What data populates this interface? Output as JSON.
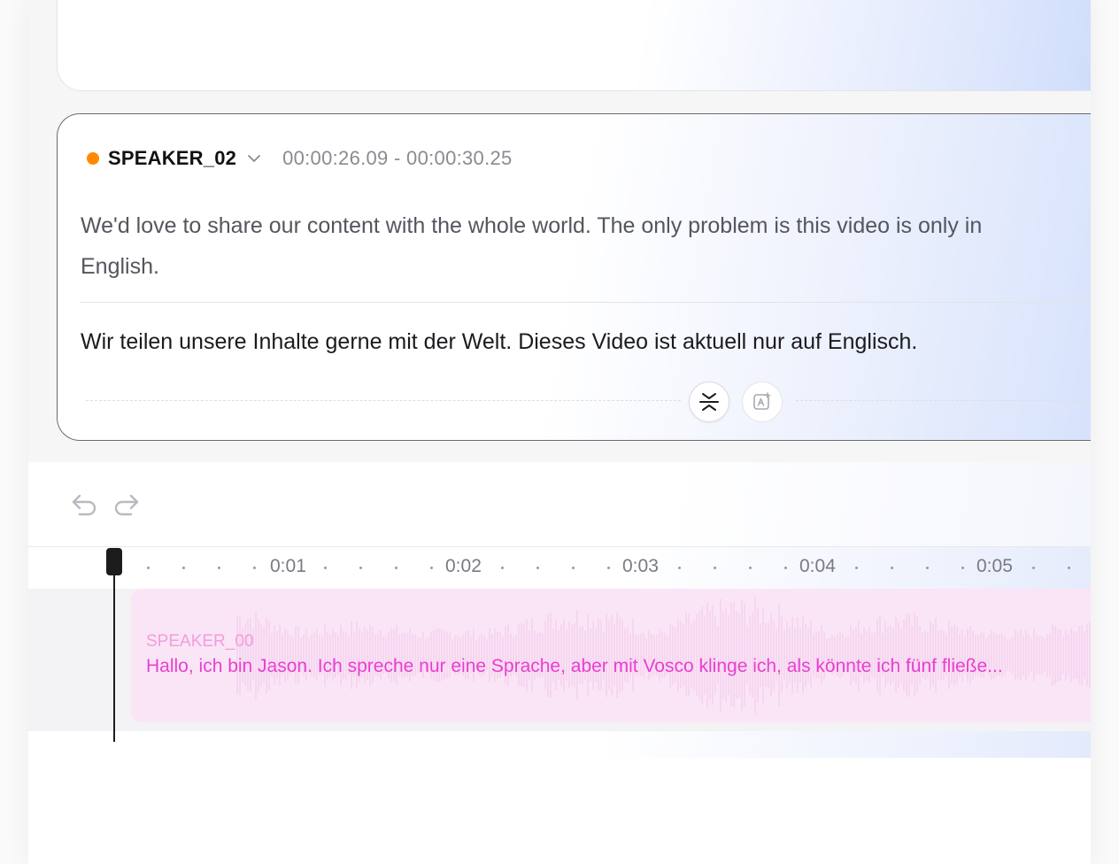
{
  "previous_card": {
    "text": ""
  },
  "segment": {
    "speaker_name": "SPEAKER_02",
    "speaker_color": "#ff8a00",
    "timecode": "00:00:26.09 - 00:00:30.25",
    "source_line1": "We'd love to share our content with the whole world. The only problem is this video is only in",
    "source_line2": "English.",
    "translation": "Wir teilen unsere Inhalte gerne mit der Welt. Dieses Video ist aktuell nur auf Englisch.",
    "actions": {
      "merge_icon": "merge-split-icon",
      "ai_icon": "ai-translate-icon"
    }
  },
  "toolbar": {
    "undo_icon": "undo-icon",
    "redo_icon": "redo-icon"
  },
  "timeline": {
    "ticks": [
      "0:01",
      "0:02",
      "0:03",
      "0:04",
      "0:05"
    ],
    "clip": {
      "speaker": "SPEAKER_00",
      "text": "Hallo, ich bin Jason. Ich spreche nur eine Sprache, aber mit Vosco klinge ich, als könnte ich fünf fließe...",
      "color": "#e93fd0",
      "background": "#fae5f6"
    }
  }
}
